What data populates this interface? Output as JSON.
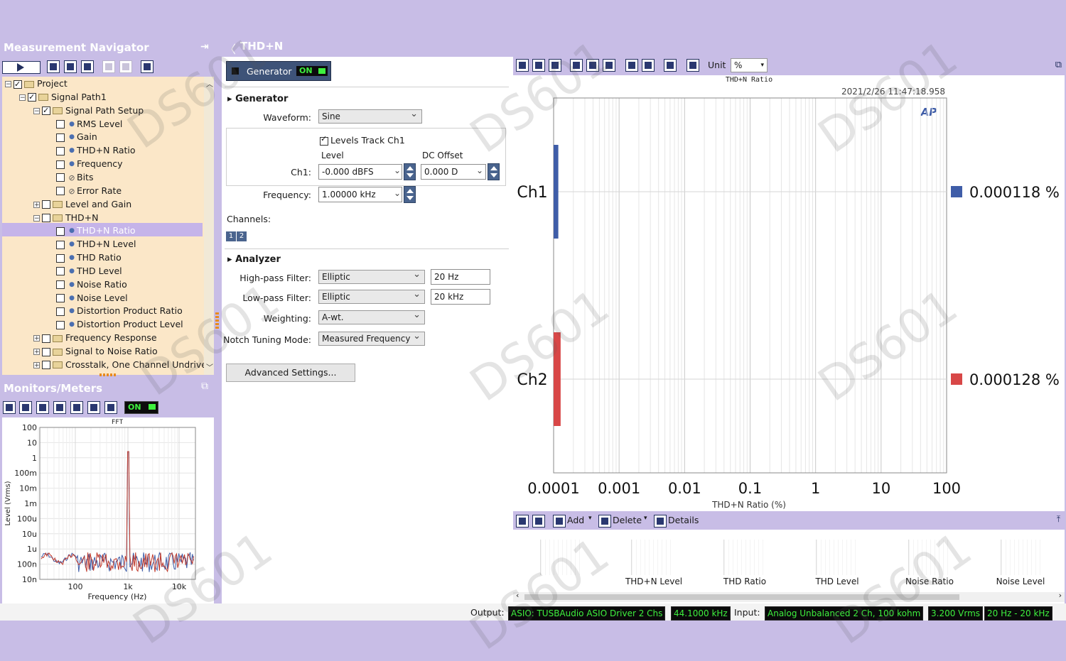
{
  "navigator": {
    "title": "Measurement Navigator",
    "tree": [
      {
        "label": "Project",
        "level": 0,
        "type": "folder",
        "checked": true,
        "expand": "-"
      },
      {
        "label": "Signal Path1",
        "level": 1,
        "type": "folder",
        "checked": true,
        "expand": "-"
      },
      {
        "label": "Signal Path Setup",
        "level": 2,
        "type": "folder",
        "checked": true,
        "expand": "-"
      },
      {
        "label": "RMS Level",
        "level": 3,
        "type": "item",
        "checked": false
      },
      {
        "label": "Gain",
        "level": 3,
        "type": "item",
        "checked": false
      },
      {
        "label": "THD+N Ratio",
        "level": 3,
        "type": "item",
        "checked": false
      },
      {
        "label": "Frequency",
        "level": 3,
        "type": "item",
        "checked": false
      },
      {
        "label": "Bits",
        "level": 3,
        "type": "blocked",
        "checked": false
      },
      {
        "label": "Error Rate",
        "level": 3,
        "type": "blocked",
        "checked": false
      },
      {
        "label": "Level and Gain",
        "level": 2,
        "type": "folder",
        "checked": false,
        "expand": "+"
      },
      {
        "label": "THD+N",
        "level": 2,
        "type": "folder",
        "checked": false,
        "expand": "-"
      },
      {
        "label": "THD+N Ratio",
        "level": 3,
        "type": "item",
        "checked": false,
        "selected": true
      },
      {
        "label": "THD+N Level",
        "level": 3,
        "type": "item",
        "checked": false
      },
      {
        "label": "THD Ratio",
        "level": 3,
        "type": "item",
        "checked": false
      },
      {
        "label": "THD Level",
        "level": 3,
        "type": "item",
        "checked": false
      },
      {
        "label": "Noise Ratio",
        "level": 3,
        "type": "item",
        "checked": false
      },
      {
        "label": "Noise Level",
        "level": 3,
        "type": "item",
        "checked": false
      },
      {
        "label": "Distortion Product Ratio",
        "level": 3,
        "type": "item",
        "checked": false
      },
      {
        "label": "Distortion Product Level",
        "level": 3,
        "type": "item",
        "checked": false
      },
      {
        "label": "Frequency Response",
        "level": 2,
        "type": "folder",
        "checked": false,
        "expand": "+"
      },
      {
        "label": "Signal to Noise Ratio",
        "level": 2,
        "type": "folder",
        "checked": false,
        "expand": "+"
      },
      {
        "label": "Crosstalk, One Channel Undriven",
        "level": 2,
        "type": "folder",
        "checked": false,
        "expand": "+"
      }
    ]
  },
  "monitors": {
    "title": "Monitors/Meters",
    "on_label": "ON",
    "fft": {
      "title": "FFT",
      "ylabel": "Level (Vrms)",
      "xlabel": "Frequency (Hz)",
      "y_ticks": [
        "100",
        "10",
        "1",
        "100m",
        "10m",
        "1m",
        "100u",
        "10u",
        "1u",
        "100n",
        "10n"
      ],
      "x_ticks": [
        "100",
        "1k",
        "10k"
      ]
    }
  },
  "measurement": {
    "title": "THD+N",
    "generator_button": "Generator",
    "generator_state": "ON",
    "generator_section": "Generator",
    "waveform_label": "Waveform:",
    "waveform_value": "Sine",
    "levels_track": "Levels Track Ch1",
    "level_header": "Level",
    "dc_offset_header": "DC Offset",
    "ch1_label": "Ch1:",
    "ch1_level": "-0.000 dBFS",
    "ch1_dc": "0.000 D",
    "frequency_label": "Frequency:",
    "frequency_value": "1.00000 kHz",
    "channels_label": "Channels:",
    "channel_buttons": [
      "1",
      "2"
    ],
    "analyzer_section": "Analyzer",
    "hpf_label": "High-pass Filter:",
    "hpf_type": "Elliptic",
    "hpf_value": "20 Hz",
    "lpf_label": "Low-pass Filter:",
    "lpf_type": "Elliptic",
    "lpf_value": "20 kHz",
    "weighting_label": "Weighting:",
    "weighting_value": "A-wt.",
    "notch_label": "Notch Tuning Mode:",
    "notch_value": "Measured Frequency",
    "advanced_button": "Advanced Settings..."
  },
  "graph_toolbar": {
    "unit_label": "Unit",
    "unit_value": "%"
  },
  "chart_data": {
    "type": "bar",
    "orientation": "horizontal",
    "title": "THD+N Ratio",
    "timestamp": "2021/2/26 11:47:18.958",
    "logo": "AP",
    "xlabel": "THD+N Ratio (%)",
    "x_scale": "log",
    "xlim": [
      0.0001,
      100
    ],
    "x_ticks": [
      "0.0001",
      "0.001",
      "0.01",
      "0.1",
      "1",
      "10",
      "100"
    ],
    "grid": true,
    "categories": [
      "Ch1",
      "Ch2"
    ],
    "values": [
      0.000118,
      0.000128
    ],
    "value_labels": [
      "0.000118 %",
      "0.000128 %"
    ],
    "colors": [
      "#3f5da8",
      "#d84747"
    ]
  },
  "results_toolbar": {
    "add_label": "Add",
    "delete_label": "Delete",
    "details_label": "Details"
  },
  "thumbnails": [
    "THD+N Level",
    "THD Ratio",
    "THD Level",
    "Noise Ratio",
    "Noise Level"
  ],
  "status": {
    "output_label": "Output:",
    "output_device": "ASIO: TUSBAudio ASIO Driver 2 Chs",
    "output_rate": "44.1000 kHz",
    "input_label": "Input:",
    "input_device": "Analog Unbalanced 2 Ch, 100 kohm",
    "input_range": "3.200 Vrms",
    "input_bw": "20 Hz - 20 kHz"
  },
  "watermark": "DS601"
}
